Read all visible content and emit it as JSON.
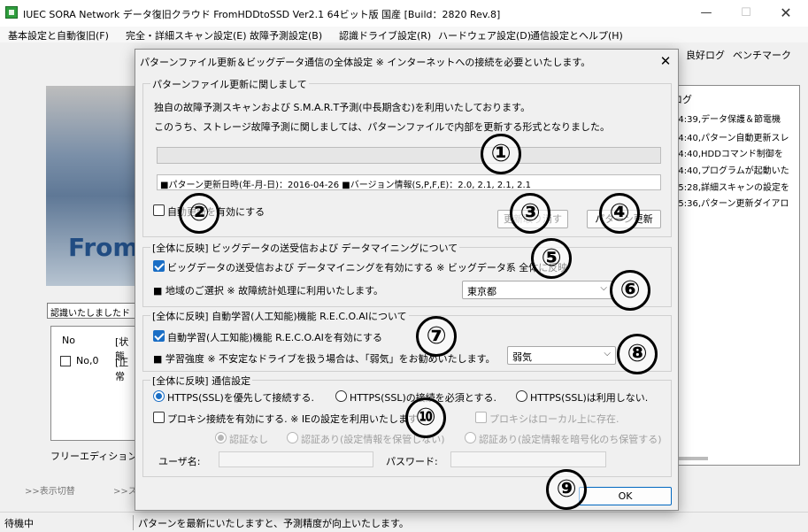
{
  "app": {
    "title": "IUEC SORA Network データ復旧クラウド FromHDDtoSSD Ver2.1 64ビット版 国産 [Build：2820 Rev.8]",
    "menu": [
      "基本設定と自動復旧(F)",
      "完全・詳細スキャン設定(E)",
      "故障予測設定(B)",
      "認識ドライブ設定(R)",
      "ハードウェア設定(D)",
      "通信設定とヘルプ(H)"
    ],
    "window_controls": {
      "minimize": "—",
      "maximize": "☐",
      "close": "✕"
    }
  },
  "background": {
    "banner_text": "From",
    "recognized_label": "認識いたしましたド",
    "drive_list": {
      "col_no": "No",
      "col_status": "[状態",
      "row_no": "No,0",
      "row_status": "[正常"
    },
    "edition": "フリーエディション",
    "toggle_link": ">>表示切替",
    "toggle_link2": ">>ス",
    "tabs": [
      "良好ログ",
      "ベンチマーク"
    ],
    "log_title": "ログ",
    "log_lines": [
      "44:39,データ保護＆節電機",
      "44:40,パターン自動更新スレ",
      "44:40,HDDコマンド制御を",
      "44:40,プログラムが起動いた",
      "45:28,詳細スキャンの設定を",
      "45:36,パターン更新ダイアロ"
    ]
  },
  "status": {
    "left": "待機中",
    "message": "パターンを最新にいたしますと、予測精度が向上いたします。"
  },
  "dialog": {
    "title": "パターンファイル更新＆ビッグデータ通信の全体設定 ※ インターネットへの接続を必要といたします。",
    "close": "✕",
    "pattern": {
      "group": "パターンファイル更新に関しまして",
      "line1": "独自の故障予測スキャンおよび S.M.A.R.T予測(中長期含む)を利用いたしております。",
      "line2": "このうち、ストレージ故障予測に関しましては、パターンファイルで内部を更新する形式となりました。",
      "progress": 0,
      "info": "■パターン更新日時(年-月-日)：2016-04-26 ■バージョン情報(S,P,F,E)：2.0, 2.1, 2.1, 2.1",
      "auto_update_label": "自動更新を有効にする",
      "auto_update_checked": false,
      "cancel_button": "更新取り消す",
      "update_button": "パターン更新"
    },
    "bigdata": {
      "group": "[全体に反映] ビッグデータの送受信および データマイニングについて",
      "enable_label": "ビッグデータの送受信および データマイニングを有効にする ※ ビッグデータ系 全体に反映",
      "enable_checked": true,
      "region_label": "■ 地域のご選択 ※ 故障統計処理に利用いたします。",
      "region_value": "東京都"
    },
    "ai": {
      "group": "[全体に反映] 自動学習(人工知能)機能 R.E.C.O.AIについて",
      "enable_label": "自動学習(人工知能)機能 R.E.C.O.AIを有効にする",
      "enable_checked": true,
      "strength_label": "■ 学習強度 ※ 不安定なドライブを扱う場合は、「弱気」をお勧めいたします。",
      "strength_value": "弱気"
    },
    "comm": {
      "group": "[全体に反映] 通信設定",
      "radio1": "HTTPS(SSL)を優先して接続する.",
      "radio2": "HTTPS(SSL)の接続を必須とする.",
      "radio3": "HTTPS(SSL)は利用しない.",
      "proxy_label": "プロキシ接続を有効にする. ※ IEの設定を利用いたします.",
      "proxy_local_label": "プロキシはローカル上に存在.",
      "auth1": "認証なし",
      "auth2": "認証あり(設定情報を保管しない)",
      "auth3": "認証あり(設定情報を暗号化のち保管する)",
      "user_label": "ユーザ名:",
      "pass_label": "パスワード:"
    },
    "ok_button": "OK"
  },
  "badges": [
    "①",
    "②",
    "③",
    "④",
    "⑤",
    "⑥",
    "⑦",
    "⑧",
    "⑨",
    "⑩"
  ],
  "colors": {
    "accent": "#1a6ec5",
    "app_icon": "#2e9d3c",
    "disabled": "#a0a0a0"
  }
}
